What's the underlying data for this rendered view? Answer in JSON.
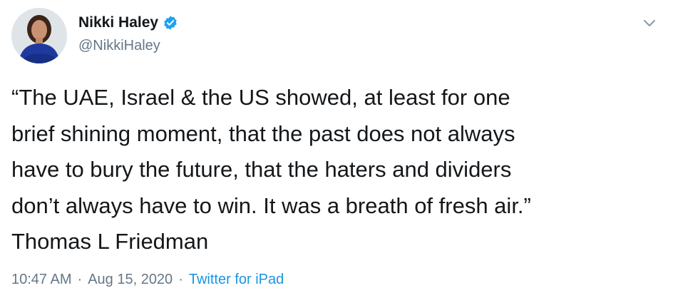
{
  "author": {
    "display_name": "Nikki Haley",
    "handle": "@NikkiHaley",
    "verified_icon": "verified-badge-icon",
    "avatar_icon": "avatar-photo"
  },
  "tweet": {
    "text": "“The UAE, Israel & the US showed, at least for one\nbrief shining moment, that the past does not always\nhave to bury the future, that the haters and dividers\ndon’t always have to win. It was a breath of fresh air.”\nThomas L Friedman"
  },
  "meta": {
    "time": "10:47 AM",
    "separator": "·",
    "date": "Aug 15, 2020",
    "source": "Twitter for iPad"
  },
  "menu": {
    "icon": "chevron-down-icon"
  },
  "colors": {
    "verified": "#1da1f2",
    "link": "#1b95e0",
    "secondary_text": "#657786",
    "primary_text": "#14171a"
  }
}
